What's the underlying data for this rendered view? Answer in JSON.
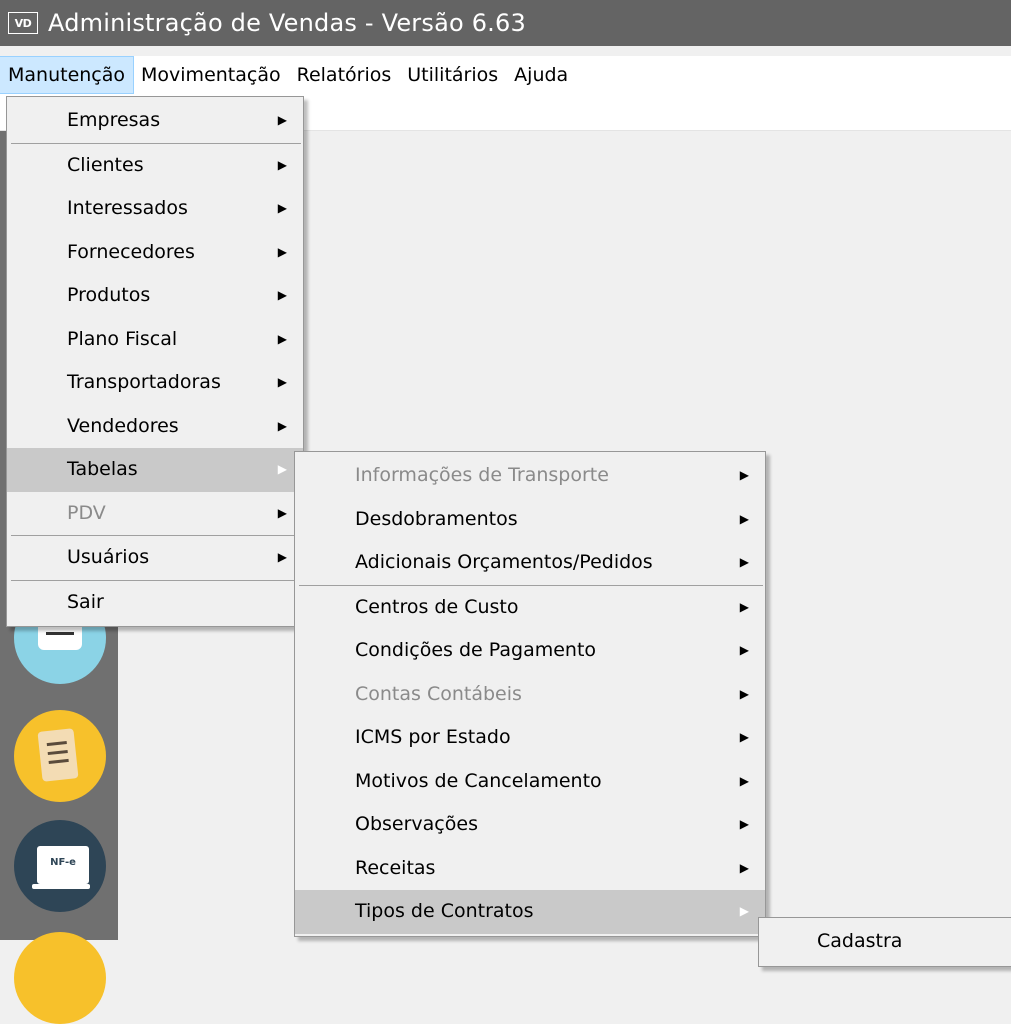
{
  "window": {
    "icon_text": "VD",
    "title": "Administração de Vendas - Versão 6.63"
  },
  "menubar": [
    "Manutenção",
    "Movimentação",
    "Relatórios",
    "Utilitários",
    "Ajuda"
  ],
  "manutencao_menu": [
    {
      "label": "Empresas",
      "submenu": true,
      "disabled": false,
      "sep_after": true
    },
    {
      "label": "Clientes",
      "submenu": true,
      "disabled": false
    },
    {
      "label": "Interessados",
      "submenu": true,
      "disabled": false
    },
    {
      "label": "Fornecedores",
      "submenu": true,
      "disabled": false
    },
    {
      "label": "Produtos",
      "submenu": true,
      "disabled": false
    },
    {
      "label": "Plano Fiscal",
      "submenu": true,
      "disabled": false
    },
    {
      "label": "Transportadoras",
      "submenu": true,
      "disabled": false
    },
    {
      "label": "Vendedores",
      "submenu": true,
      "disabled": false
    },
    {
      "label": "Tabelas",
      "submenu": true,
      "disabled": false,
      "highlighted": true
    },
    {
      "label": "PDV",
      "submenu": true,
      "disabled": true,
      "sep_after": true
    },
    {
      "label": "Usuários",
      "submenu": true,
      "disabled": false,
      "sep_after": true
    },
    {
      "label": "Sair",
      "submenu": false,
      "disabled": false
    }
  ],
  "tabelas_menu": [
    {
      "label": "Informações de Transporte",
      "disabled": true
    },
    {
      "label": "Desdobramentos",
      "disabled": false
    },
    {
      "label": "Adicionais Orçamentos/Pedidos",
      "disabled": false,
      "sep_after": true
    },
    {
      "label": "Centros de Custo",
      "disabled": false
    },
    {
      "label": "Condições de Pagamento",
      "disabled": false
    },
    {
      "label": "Contas Contábeis",
      "disabled": true
    },
    {
      "label": "ICMS por Estado",
      "disabled": false
    },
    {
      "label": "Motivos de Cancelamento",
      "disabled": false
    },
    {
      "label": "Observações",
      "disabled": false
    },
    {
      "label": "Receitas",
      "disabled": false
    },
    {
      "label": "Tipos de Contratos",
      "disabled": false,
      "highlighted": true
    }
  ],
  "contratos_menu": [
    {
      "label": "Cadastra"
    }
  ],
  "sidebar_icons": [
    "list-icon",
    "document-edit-icon",
    "nfe-laptop-icon",
    "app-icon"
  ],
  "colors": {
    "titlebar": "#646464",
    "highlight": "#c9c9c9",
    "menubar_active": "#cce8ff"
  }
}
